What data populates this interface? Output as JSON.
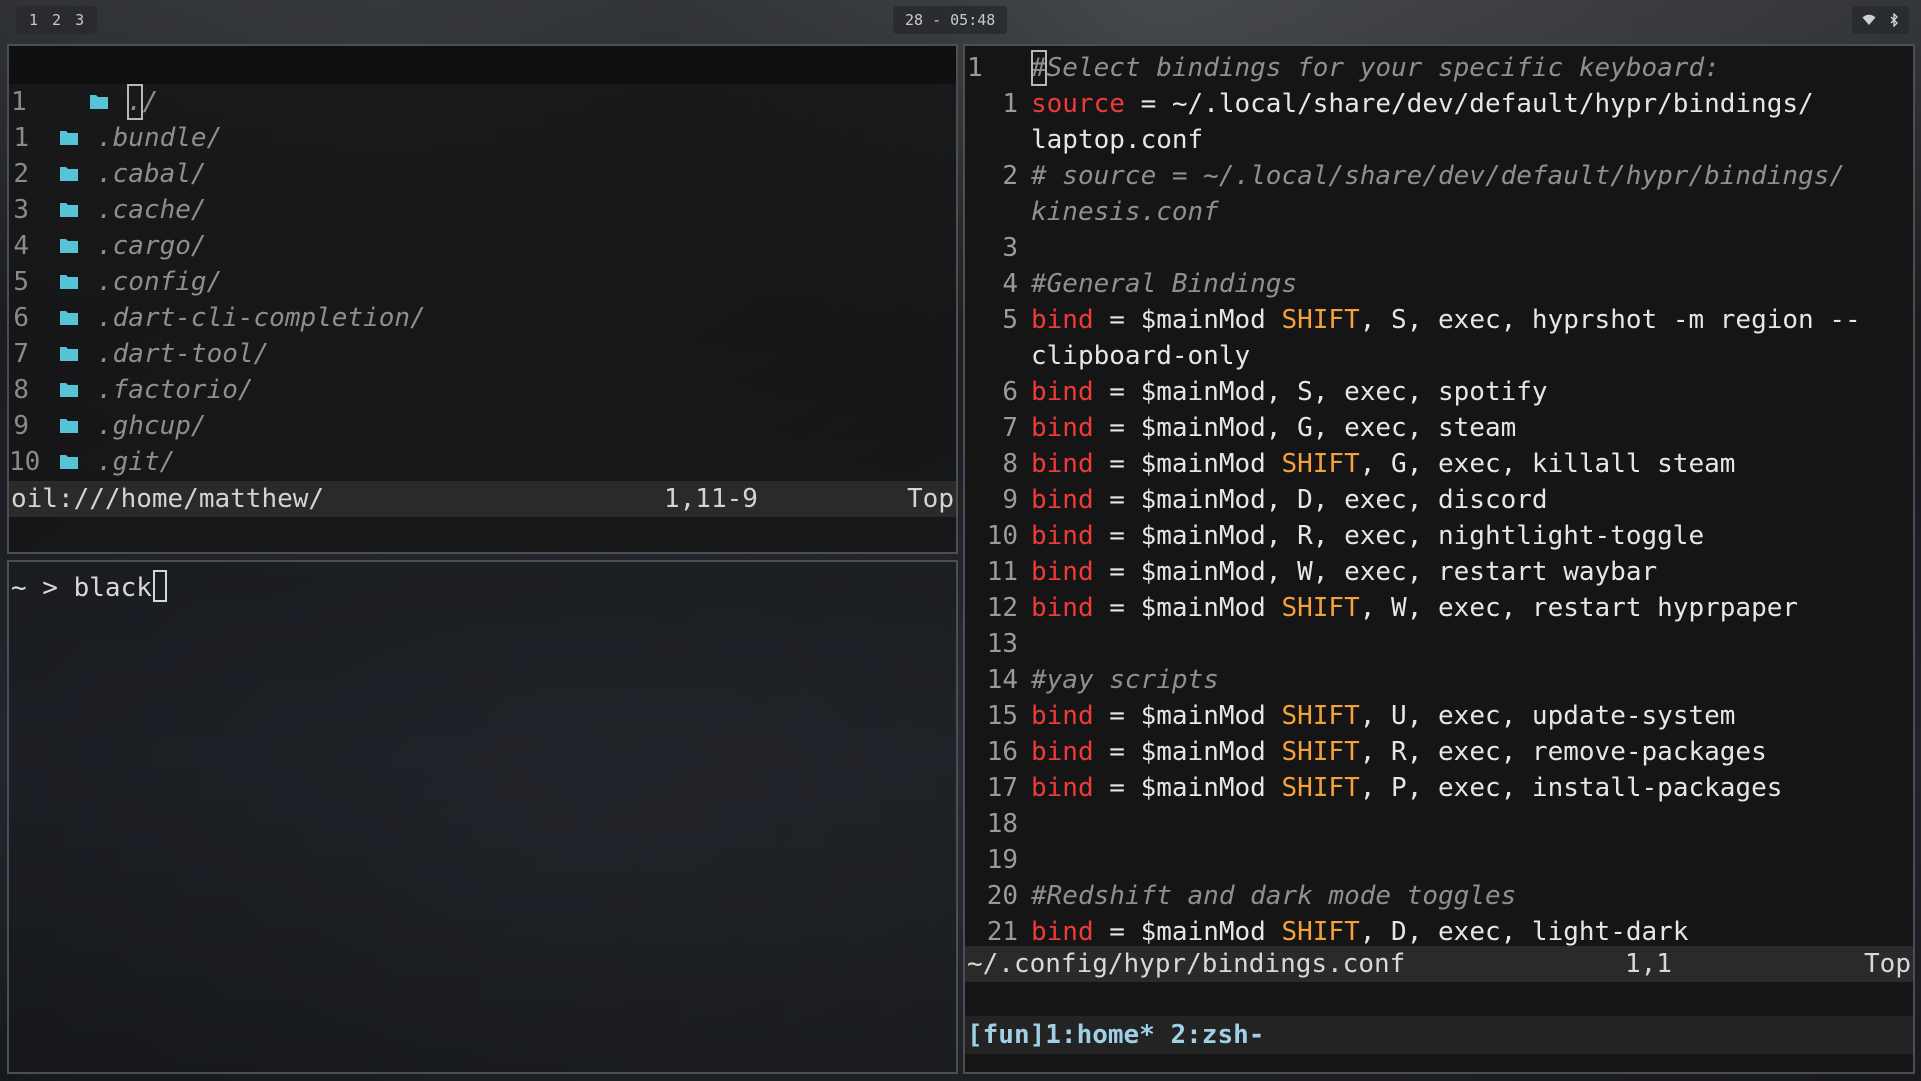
{
  "topbar": {
    "workspaces": [
      "1",
      "2",
      "3"
    ],
    "clock": "28 - 05:48",
    "tray_icons": [
      "wifi-icon",
      "bluetooth-icon"
    ]
  },
  "oil": {
    "rows": [
      {
        "num": "1",
        "name": "./",
        "cursor": "."
      },
      {
        "num": "1",
        "name": ".bundle/"
      },
      {
        "num": "2",
        "name": ".cabal/"
      },
      {
        "num": "3",
        "name": ".cache/"
      },
      {
        "num": "4",
        "name": ".cargo/"
      },
      {
        "num": "5",
        "name": ".config/"
      },
      {
        "num": "6",
        "name": ".dart-cli-completion/"
      },
      {
        "num": "7",
        "name": ".dart-tool/"
      },
      {
        "num": "8",
        "name": ".factorio/"
      },
      {
        "num": "9",
        "name": ".ghcup/"
      },
      {
        "num": "10",
        "name": ".git/"
      }
    ],
    "status": {
      "path": "oil:///home/matthew/",
      "position": "1,11-9",
      "scroll": "Top"
    },
    "colors": {
      "folder": "#56c3d6"
    }
  },
  "terminal": {
    "prompt": "~ > ",
    "input": "black"
  },
  "vim": {
    "lines": [
      {
        "num": "1",
        "first": true,
        "segments": [
          {
            "t": "#",
            "c": "comment",
            "cursor": true
          },
          {
            "t": "Select bindings for your specific keyboard:",
            "c": "comment"
          }
        ]
      },
      {
        "num": "1",
        "segments": [
          {
            "t": "source",
            "c": "red"
          },
          {
            "t": " = ~/.local/share/dev/default/hypr/bindings/"
          }
        ]
      },
      {
        "num": "",
        "segments": [
          {
            "t": "laptop.conf"
          }
        ]
      },
      {
        "num": "2",
        "segments": [
          {
            "t": "# source = ~/.local/share/dev/default/hypr/bindings/",
            "c": "comment"
          }
        ]
      },
      {
        "num": "",
        "segments": [
          {
            "t": "kinesis.conf",
            "c": "comment"
          }
        ]
      },
      {
        "num": "3",
        "segments": []
      },
      {
        "num": "4",
        "segments": [
          {
            "t": "#General Bindings",
            "c": "comment"
          }
        ]
      },
      {
        "num": "5",
        "segments": [
          {
            "t": "bind",
            "c": "red"
          },
          {
            "t": " = $mainMod "
          },
          {
            "t": "SHIFT",
            "c": "orange"
          },
          {
            "t": ", S, exec, hyprshot -m region --"
          }
        ]
      },
      {
        "num": "",
        "segments": [
          {
            "t": "clipboard-only"
          }
        ]
      },
      {
        "num": "6",
        "segments": [
          {
            "t": "bind",
            "c": "red"
          },
          {
            "t": " = $mainMod, S, exec, spotify"
          }
        ]
      },
      {
        "num": "7",
        "segments": [
          {
            "t": "bind",
            "c": "red"
          },
          {
            "t": " = $mainMod, G, exec, steam"
          }
        ]
      },
      {
        "num": "8",
        "segments": [
          {
            "t": "bind",
            "c": "red"
          },
          {
            "t": " = $mainMod "
          },
          {
            "t": "SHIFT",
            "c": "orange"
          },
          {
            "t": ", G, exec, killall steam"
          }
        ]
      },
      {
        "num": "9",
        "segments": [
          {
            "t": "bind",
            "c": "red"
          },
          {
            "t": " = $mainMod, D, exec, discord"
          }
        ]
      },
      {
        "num": "10",
        "segments": [
          {
            "t": "bind",
            "c": "red"
          },
          {
            "t": " = $mainMod, R, exec, nightlight-toggle"
          }
        ]
      },
      {
        "num": "11",
        "segments": [
          {
            "t": "bind",
            "c": "red"
          },
          {
            "t": " = $mainMod, W, exec, restart waybar"
          }
        ]
      },
      {
        "num": "12",
        "segments": [
          {
            "t": "bind",
            "c": "red"
          },
          {
            "t": " = $mainMod "
          },
          {
            "t": "SHIFT",
            "c": "orange"
          },
          {
            "t": ", W, exec, restart hyprpaper"
          }
        ]
      },
      {
        "num": "13",
        "segments": []
      },
      {
        "num": "14",
        "segments": [
          {
            "t": "#yay scripts",
            "c": "comment"
          }
        ]
      },
      {
        "num": "15",
        "segments": [
          {
            "t": "bind",
            "c": "red"
          },
          {
            "t": " = $mainMod "
          },
          {
            "t": "SHIFT",
            "c": "orange"
          },
          {
            "t": ", U, exec, update-system"
          }
        ]
      },
      {
        "num": "16",
        "segments": [
          {
            "t": "bind",
            "c": "red"
          },
          {
            "t": " = $mainMod "
          },
          {
            "t": "SHIFT",
            "c": "orange"
          },
          {
            "t": ", R, exec, remove-packages"
          }
        ]
      },
      {
        "num": "17",
        "segments": [
          {
            "t": "bind",
            "c": "red"
          },
          {
            "t": " = $mainMod "
          },
          {
            "t": "SHIFT",
            "c": "orange"
          },
          {
            "t": ", P, exec, install-packages"
          }
        ]
      },
      {
        "num": "18",
        "segments": []
      },
      {
        "num": "19",
        "segments": []
      },
      {
        "num": "20",
        "segments": [
          {
            "t": "#Redshift and dark mode toggles",
            "c": "comment"
          }
        ]
      },
      {
        "num": "21",
        "segments": [
          {
            "t": "bind",
            "c": "red"
          },
          {
            "t": " = $mainMod "
          },
          {
            "t": "SHIFT",
            "c": "orange"
          },
          {
            "t": ", D, exec, light-dark"
          }
        ]
      }
    ],
    "status": {
      "path": "~/.config/hypr/bindings.conf",
      "position": "1,1",
      "scroll": "Top"
    },
    "tmux": "[fun]1:home* 2:zsh-"
  }
}
